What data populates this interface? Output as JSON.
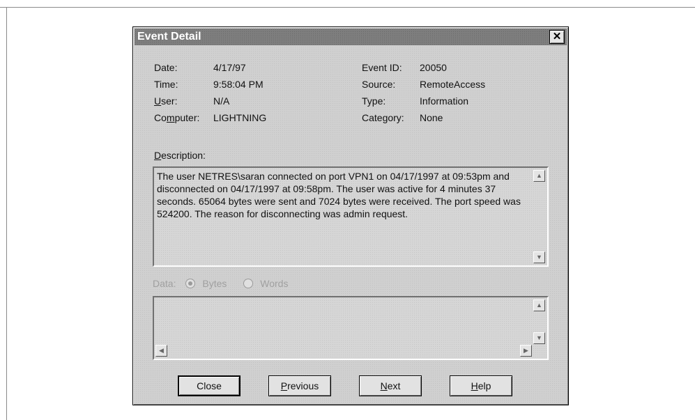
{
  "dialog": {
    "title": "Event Detail",
    "close_glyph": "✕"
  },
  "fields": {
    "date_label": "Date:",
    "date_value": "4/17/97",
    "time_label": "Time:",
    "time_value": "9:58:04 PM",
    "user_label_u": "U",
    "user_label_rest": "ser:",
    "user_value": "N/A",
    "computer_label_pre": "Co",
    "computer_label_u": "m",
    "computer_label_rest": "puter:",
    "computer_value": "LIGHTNING",
    "event_id_label": "Event ID:",
    "event_id_value": "20050",
    "source_label": "Source:",
    "source_value": "RemoteAccess",
    "type_label": "Type:",
    "type_value": "Information",
    "category_label": "Category:",
    "category_value": "None"
  },
  "description": {
    "label_u": "D",
    "label_rest": "escription:",
    "text": "The user NETRES\\saran connected on port VPN1 on 04/17/1997 at 09:53pm and disconnected on 04/17/1997 at 09:58pm.  The user was active for 4 minutes 37 seconds.  65064 bytes were sent and 7024 bytes were received.  The port speed was 524200.  The reason for disconnecting was admin request."
  },
  "data_section": {
    "label": "Data:",
    "bytes_label": "Bytes",
    "words_label": "Words",
    "selected": "Bytes"
  },
  "buttons": {
    "close": "Close",
    "previous_u": "P",
    "previous_rest": "revious",
    "next_u": "N",
    "next_rest": "ext",
    "help_u": "H",
    "help_rest": "elp"
  }
}
